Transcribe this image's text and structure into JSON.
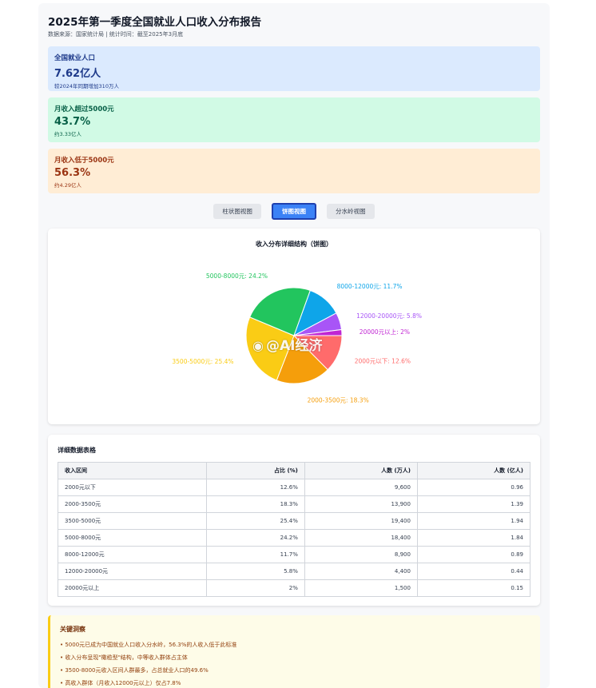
{
  "header": {
    "title": "2025年第一季度全国就业人口收入分布报告",
    "subtitle": "数据来源：国家统计局 | 统计时间：截至2025年3月底"
  },
  "stats": [
    {
      "label": "全国就业人口",
      "value": "7.62亿人",
      "note": "较2024年同期增加310万人"
    },
    {
      "label": "月收入超过5000元",
      "value": "43.7%",
      "note": "约3.33亿人"
    },
    {
      "label": "月收入低于5000元",
      "value": "56.3%",
      "note": "约4.29亿人"
    }
  ],
  "tabs": [
    {
      "label": "柱状图视图",
      "active": false
    },
    {
      "label": "饼图视图",
      "active": true
    },
    {
      "label": "分水岭视图",
      "active": false
    }
  ],
  "chart_data": {
    "type": "pie",
    "title": "收入分布详细结构（饼图）",
    "slices": [
      {
        "label": "2000元以下",
        "value": 12.6,
        "text": "2000元以下: 12.6%",
        "color": "#ff6b6b"
      },
      {
        "label": "2000-3500元",
        "value": 18.3,
        "text": "2000-3500元: 18.3%",
        "color": "#f59e0b"
      },
      {
        "label": "3500-5000元",
        "value": 25.4,
        "text": "3500-5000元: 25.4%",
        "color": "#facc15"
      },
      {
        "label": "5000-8000元",
        "value": 24.2,
        "text": "5000-8000元: 24.2%",
        "color": "#22c55e"
      },
      {
        "label": "8000-12000元",
        "value": 11.7,
        "text": "8000-12000元: 11.7%",
        "color": "#0ea5e9"
      },
      {
        "label": "12000-20000元",
        "value": 5.8,
        "text": "12000-20000元: 5.8%",
        "color": "#a855f7"
      },
      {
        "label": "20000元以上",
        "value": 2,
        "text": "20000元以上: 2%",
        "color": "#c026d3"
      }
    ]
  },
  "watermark": "@AI经济",
  "table": {
    "title": "详细数据表格",
    "headers": [
      "收入区间",
      "占比 (%)",
      "人数 (万人)",
      "人数 (亿人)"
    ],
    "rows": [
      [
        "2000元以下",
        "12.6%",
        "9,600",
        "0.96"
      ],
      [
        "2000-3500元",
        "18.3%",
        "13,900",
        "1.39"
      ],
      [
        "3500-5000元",
        "25.4%",
        "19,400",
        "1.94"
      ],
      [
        "5000-8000元",
        "24.2%",
        "18,400",
        "1.84"
      ],
      [
        "8000-12000元",
        "11.7%",
        "8,900",
        "0.89"
      ],
      [
        "12000-20000元",
        "5.8%",
        "4,400",
        "0.44"
      ],
      [
        "20000元以上",
        "2%",
        "1,500",
        "0.15"
      ]
    ]
  },
  "insights": {
    "title": "关键洞察",
    "items": [
      "• 5000元已成为中国就业人口收入分水岭，56.3%的人收入低于此标准",
      "• 收入分布呈现\"橄榄型\"结构，中等收入群体占主体",
      "• 3500-8000元收入区间人群最多，占总就业人口的49.6%",
      "• 高收入群体（月收入12000元以上）仅占7.8%"
    ]
  }
}
